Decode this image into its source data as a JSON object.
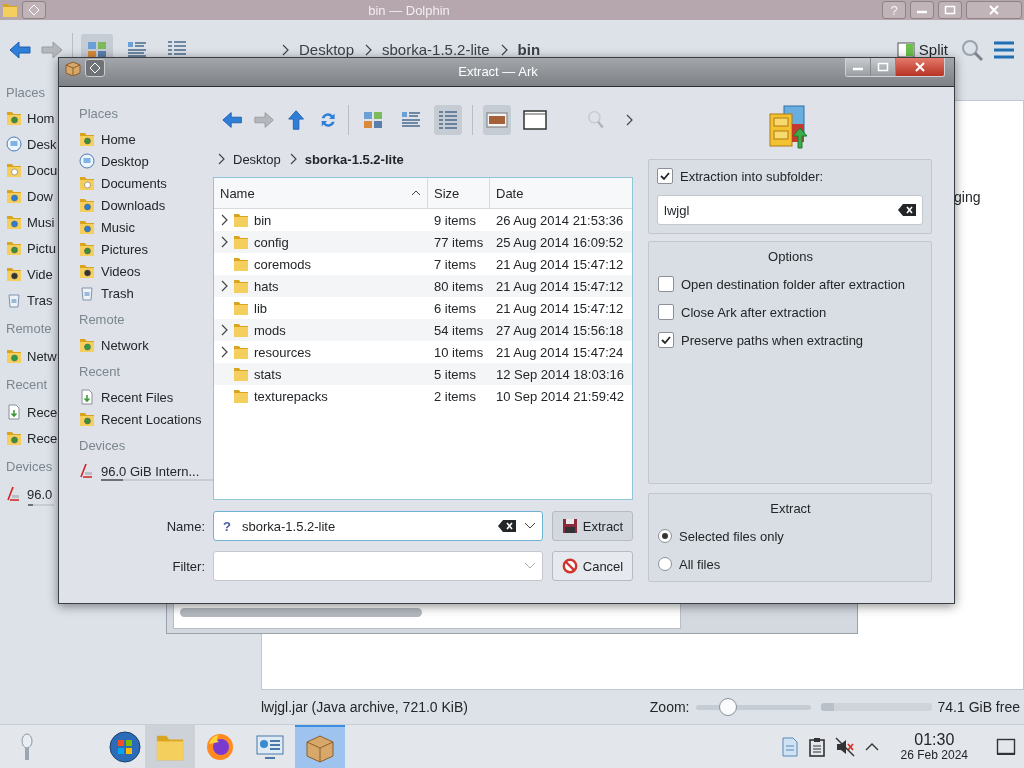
{
  "dolphin": {
    "title": "bin — Dolphin",
    "help_glyph": "?",
    "back": {
      "disabled": false
    },
    "forward": {
      "disabled": true
    },
    "view_modes": [
      {
        "selected": true
      },
      {
        "selected": false
      },
      {
        "selected": false
      }
    ],
    "breadcrumb": [
      {
        "label": "Desktop",
        "current": false
      },
      {
        "label": "sborka-1.5.2-lite",
        "current": false
      },
      {
        "label": "bin",
        "current": true
      }
    ],
    "split_label": "Split",
    "places": [
      {
        "title": "Places",
        "items": [
          {
            "label": "Hom"
          },
          {
            "label": "Desk"
          },
          {
            "label": "Docu"
          },
          {
            "label": "Dow"
          },
          {
            "label": "Musi"
          },
          {
            "label": "Pictu"
          },
          {
            "label": "Vide"
          },
          {
            "label": "Tras"
          }
        ]
      },
      {
        "title": "Remote",
        "items": [
          {
            "label": "Netw"
          }
        ]
      },
      {
        "title": "Recent",
        "items": [
          {
            "label": "Rece"
          },
          {
            "label": "Rece"
          }
        ]
      },
      {
        "title": "Devices",
        "items": [
          {
            "label": "96.0",
            "level": 0.2
          }
        ]
      }
    ],
    "content_text": "ging",
    "status_text": "lwjgl.jar (Java archive, 721.0 KiB)",
    "zoom_label": "Zoom:",
    "zoom": {
      "level": 0.28
    },
    "storage": {
      "level": 0.12
    },
    "free_space": "74.1 GiB free"
  },
  "dialog": {
    "title": "Extract — Ark",
    "places": [
      {
        "title": "Places",
        "items": [
          {
            "label": "Home"
          },
          {
            "label": "Desktop"
          },
          {
            "label": "Documents"
          },
          {
            "label": "Downloads"
          },
          {
            "label": "Music"
          },
          {
            "label": "Pictures"
          },
          {
            "label": "Videos"
          },
          {
            "label": "Trash"
          }
        ]
      },
      {
        "title": "Remote",
        "items": [
          {
            "label": "Network"
          }
        ]
      },
      {
        "title": "Recent",
        "items": [
          {
            "label": "Recent Files"
          },
          {
            "label": "Recent Locations"
          }
        ]
      },
      {
        "title": "Devices",
        "items": [
          {
            "label": "96.0 GiB Intern...",
            "level": 0.2
          }
        ]
      }
    ],
    "back": {
      "disabled": false
    },
    "forward": {
      "disabled": true
    },
    "view_modes": [
      {
        "selected": false
      },
      {
        "selected": false
      },
      {
        "selected": true
      }
    ],
    "panels": [
      {
        "on": true
      },
      {
        "on": false
      }
    ],
    "breadcrumb": [
      {
        "label": "Desktop",
        "current": false
      },
      {
        "label": "sborka-1.5.2-lite",
        "current": true
      }
    ],
    "table": {
      "columns": [
        {
          "label": "Name",
          "sorted": true
        },
        {
          "label": "Size",
          "sorted": false
        },
        {
          "label": "Date",
          "sorted": false
        }
      ],
      "rows": [
        {
          "name": "bin",
          "size": "9 items",
          "date": "26 Aug 2014 21:53:36",
          "expandable": true
        },
        {
          "name": "config",
          "size": "77 items",
          "date": "25 Aug 2014 16:09:52",
          "expandable": true
        },
        {
          "name": "coremods",
          "size": "7 items",
          "date": "21 Aug 2014 15:47:12",
          "expandable": false
        },
        {
          "name": "hats",
          "size": "80 items",
          "date": "21 Aug 2014 15:47:12",
          "expandable": true
        },
        {
          "name": "lib",
          "size": "6 items",
          "date": "21 Aug 2014 15:47:12",
          "expandable": false
        },
        {
          "name": "mods",
          "size": "54 items",
          "date": "27 Aug 2014 15:56:18",
          "expandable": true
        },
        {
          "name": "resources",
          "size": "10 items",
          "date": "21 Aug 2014 15:47:24",
          "expandable": true
        },
        {
          "name": "stats",
          "size": "5 items",
          "date": "12 Sep 2014 18:03:16",
          "expandable": false
        },
        {
          "name": "texturepacks",
          "size": "2 items",
          "date": "10 Sep 2014 21:59:42",
          "expandable": false
        }
      ]
    },
    "name_label": "Name:",
    "name_field": {
      "mime_glyph": "?",
      "value": "sborka-1.5.2-lite"
    },
    "filter_label": "Filter:",
    "buttons": [
      {
        "kind": "extract",
        "label": "Extract"
      },
      {
        "kind": "cancel",
        "label": "Cancel"
      }
    ],
    "subfolder": {
      "label": "Extraction into subfolder:",
      "checked": true,
      "value": "lwjgl"
    },
    "options": {
      "title": "Options",
      "items": [
        {
          "label": "Open destination folder after extraction",
          "checked": false
        },
        {
          "label": "Close Ark after extraction",
          "checked": false
        },
        {
          "label": "Preserve paths when extracting",
          "checked": true
        }
      ]
    },
    "extract": {
      "title": "Extract",
      "items": [
        {
          "label": "Selected files only",
          "selected": true
        },
        {
          "label": "All files",
          "selected": false
        }
      ]
    }
  },
  "taskbar": {
    "tasks": [
      {
        "kind": "files",
        "open": true,
        "selected": false
      },
      {
        "kind": "browser",
        "open": false,
        "selected": false
      },
      {
        "kind": "settings",
        "open": false,
        "selected": false
      },
      {
        "kind": "archiver",
        "open": true,
        "selected": true
      }
    ],
    "time": "01:30",
    "date": "26 Feb 2024"
  }
}
